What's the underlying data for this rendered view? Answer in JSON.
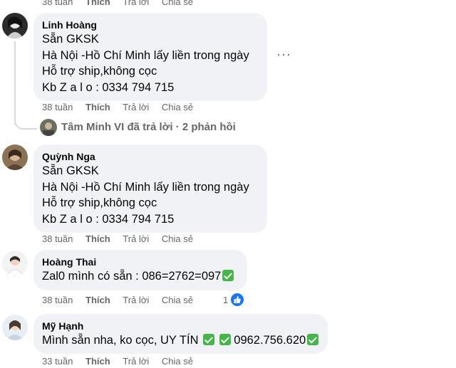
{
  "top_actions": {
    "time": "38 tuần",
    "like": "Thích",
    "reply": "Trả lời",
    "share": "Chia sẻ"
  },
  "comments": [
    {
      "author": "Linh Hoàng",
      "lines": [
        "Sẵn GKSK",
        "Hà Nội -Hồ Chí Minh lấy liền trong ngày",
        "Hỗ trợ ship,không cọc",
        "Kb Z a l o : 0334 794 715"
      ],
      "time": "38 tuần",
      "like": "Thích",
      "reply": "Trả lời",
      "share": "Chia sẻ"
    },
    {
      "author": "Quỳnh Nga",
      "lines": [
        "Sẵn GKSK",
        "Hà Nội -Hồ Chí Minh lấy liền trong ngày",
        "Hỗ trợ ship,không cọc",
        "Kb Z a l o : 0334 794 715"
      ],
      "time": "38 tuần",
      "like": "Thích",
      "reply": "Trả lời",
      "share": "Chia sẻ"
    },
    {
      "author": "Hoàng Thai",
      "text": "Zal0 mình có sẵn : 086=2762=097",
      "time": "38 tuần",
      "like": "Thích",
      "reply": "Trả lời",
      "share": "Chia sẻ",
      "reaction_count": "1"
    },
    {
      "author": "Mỹ Hạnh",
      "text_a": "Mình sẵn nha, ko cọc, UY TÍN",
      "text_b": "0962.756.620",
      "time": "33 tuần",
      "like": "Thích",
      "reply": "Trả lời",
      "share": "Chia sẻ"
    }
  ],
  "reply_summary": "Tâm Minh VI đã trả lời · 2 phản hồi",
  "more_label": "···",
  "colors": {
    "bubble": "#f0f2f5",
    "meta": "#65676b",
    "check": "#45b549",
    "like": "#1877f2"
  }
}
